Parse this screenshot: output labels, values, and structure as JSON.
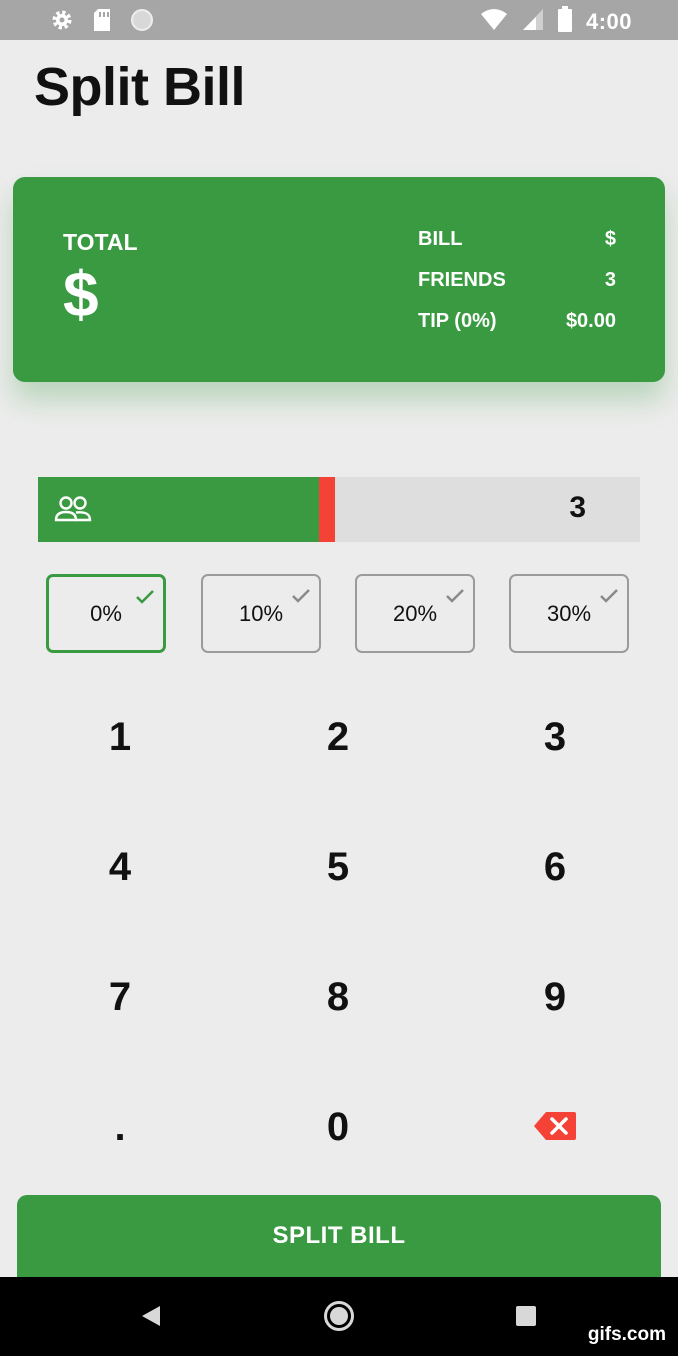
{
  "status_bar": {
    "time": "4:00",
    "left_icons": [
      "settings-icon",
      "sd-card-icon",
      "circle-notification-icon"
    ],
    "right_icons": [
      "wifi-icon",
      "signal-icon",
      "battery-icon"
    ]
  },
  "app": {
    "title": "Split Bill"
  },
  "summary": {
    "total_label": "TOTAL",
    "total_value": "$",
    "rows": [
      {
        "label": "BILL",
        "value": "$"
      },
      {
        "label": "FRIENDS",
        "value": "3"
      },
      {
        "label": "TIP (0%)",
        "value": "$0.00"
      }
    ]
  },
  "friends_slider": {
    "icon": "people-icon",
    "value": "3",
    "fill_fraction": 0.47
  },
  "tips": [
    {
      "label": "0%",
      "selected": true
    },
    {
      "label": "10%",
      "selected": false
    },
    {
      "label": "20%",
      "selected": false
    },
    {
      "label": "30%",
      "selected": false
    }
  ],
  "keypad": {
    "keys": [
      "1",
      "2",
      "3",
      "4",
      "5",
      "6",
      "7",
      "8",
      "9",
      ".",
      "0",
      "backspace"
    ]
  },
  "action": {
    "label": "SPLIT BILL"
  },
  "nav": [
    "back-icon",
    "home-icon",
    "recents-icon"
  ],
  "watermark": "gifs.com",
  "colors": {
    "accent": "#3a9a41",
    "danger": "#f44336",
    "background": "#ececec"
  }
}
